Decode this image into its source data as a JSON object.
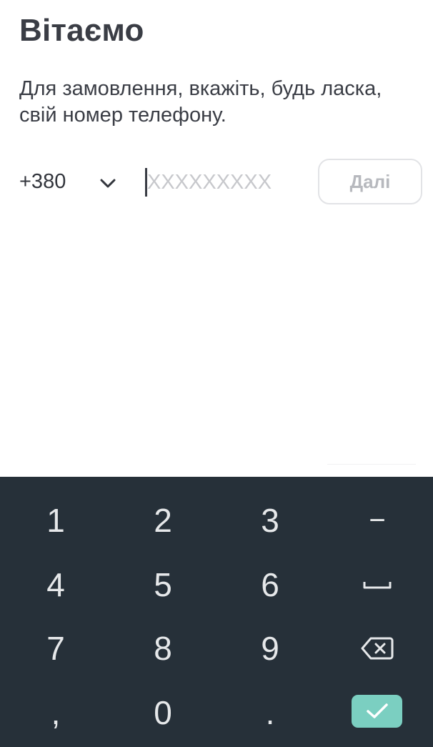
{
  "header": {
    "title": "Вітаємо",
    "subtitle": "Для замовлення, вкажіть, будь ласка, свій номер телефону."
  },
  "phone_form": {
    "country_code": "+380",
    "phone_value": "",
    "phone_placeholder": "XXXXXXXXX",
    "next_label": "Далі"
  },
  "keyboard": {
    "keys": {
      "one": "1",
      "two": "2",
      "three": "3",
      "dash": "−",
      "four": "4",
      "five": "5",
      "six": "6",
      "seven": "7",
      "eight": "8",
      "nine": "9",
      "comma": ",",
      "zero": "0",
      "period": "."
    },
    "icons": {
      "space": "space-icon",
      "backspace": "backspace-icon",
      "done": "check-icon"
    }
  },
  "colors": {
    "text": "#3a3d45",
    "keyboard_bg": "#263039",
    "done_accent": "#7bcfc1",
    "button_border": "#e2e3e6",
    "button_text": "#b7b9be"
  }
}
